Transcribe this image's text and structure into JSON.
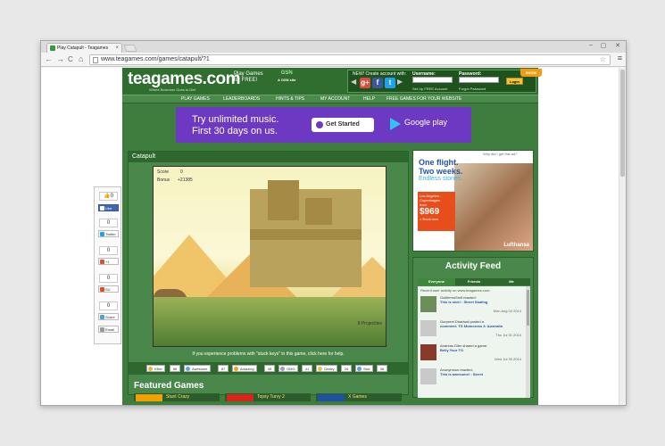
{
  "browser": {
    "tab_title": "Play Catapult - Teagames",
    "tab_close": "×",
    "url": "www.teagames.com/games/catapult/?1",
    "back": "←",
    "forward": "→",
    "reload": "C",
    "home": "⌂",
    "star": "☆",
    "menu": "≡",
    "min": "–",
    "max": "▢",
    "close": "✕"
  },
  "site": {
    "logo": "teagames.com",
    "tagline": "Where Boredom Goes to Die!",
    "play_free": [
      "Play Games",
      "for FREE!"
    ],
    "gsn": [
      "GSN",
      "A GSN site"
    ],
    "social": {
      "new_text": "NEW! Create account with:",
      "username_label": "Username:",
      "password_label": "Password:",
      "signup_link": "Set Up FREE Account",
      "forgot_link": "Forgot Password",
      "login": "Login",
      "show": "SHOW"
    },
    "nav": [
      "PLAY GAMES",
      "LEADERBOARDS",
      "HINTS & TIPS",
      "MY ACCOUNT",
      "HELP",
      "FREE GAMES FOR YOUR WEBSITE"
    ]
  },
  "top_ad": {
    "line1": "Try unlimited music.",
    "line2": "First 30 days on us.",
    "cta": "Get Started",
    "brand": "Google play"
  },
  "sharebar": {
    "like_count": "0",
    "like": "Like",
    "twitter_count": "0",
    "twitter": "Twitter",
    "gplus_count": "0",
    "gplus": "+1",
    "su_count": "0",
    "su": "SU",
    "share_count": "0",
    "share": "Share",
    "email": "Email"
  },
  "game": {
    "title": "Catapult",
    "score_label": "Score",
    "score_value": "0",
    "bonus_label": "Bonus",
    "bonus_value": "+21385",
    "projectiles": "8 Projectiles",
    "help": "If you experience problems with \"stuck keys\" in this game, click here for help.",
    "ratings": [
      {
        "label": "Killer",
        "count": "56",
        "color": "#e8b04a"
      },
      {
        "label": "Awesome",
        "count": "87",
        "color": "#6aa0e0"
      },
      {
        "label": "Amazing",
        "count": "49",
        "color": "#f0a020"
      },
      {
        "label": "OMG",
        "count": "41",
        "color": "#9a9ad8"
      },
      {
        "label": "Geeky",
        "count": "26",
        "color": "#e0c050"
      },
      {
        "label": "Sick",
        "count": "36",
        "color": "#5aa0e0"
      }
    ]
  },
  "featured": {
    "title": "Featured Games",
    "items": [
      "Stunt Crazy",
      "Topsy Turvy 2",
      "X Games"
    ]
  },
  "side_ad": {
    "why": "Why did I get this ad?",
    "headline": [
      "One flight.",
      "Two weeks."
    ],
    "sub": "Endless stories.",
    "route": "Los Angeles - Copenhagen",
    "from": "from",
    "price": "$969",
    "book": "> Book now",
    "brand": "Lufthansa"
  },
  "feed": {
    "title": "Activity Feed",
    "tabs": [
      "Everyone",
      "Friends",
      "Me"
    ],
    "intro": "Recent user activity on www.teagames.com:",
    "items": [
      {
        "name": "GuillermoSmit reacted:",
        "action": "This is sick! : Street Skating",
        "date": "Mon Aug 04 2014"
      },
      {
        "name": "Gurpreet Dhariwal posted a",
        "action": "comment: TG Motocross 3: Australia",
        "date": "Thu Jul 31 2014"
      },
      {
        "name": "Andreas Diler shared a game:",
        "action": "Belly Your TG",
        "date": "Wed Jul 30 2014"
      },
      {
        "name": "Anonymous reacted:",
        "action": "This is awesome! : Street",
        "date": ""
      }
    ]
  }
}
